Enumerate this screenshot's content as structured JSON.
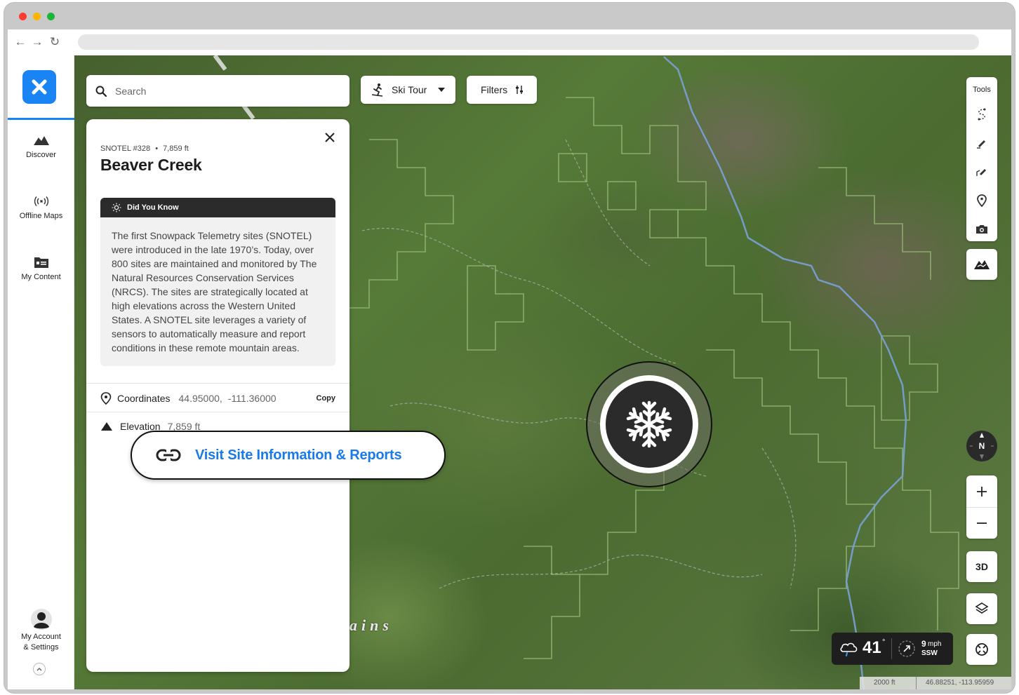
{
  "sidebar": {
    "items": [
      {
        "label": "Discover",
        "icon": "mountain-icon"
      },
      {
        "label": "Offline Maps",
        "icon": "broadcast-icon"
      },
      {
        "label": "My Content",
        "icon": "folder-icon"
      }
    ],
    "account": {
      "line1": "My Account",
      "line2": "& Settings"
    }
  },
  "search": {
    "placeholder": "Search"
  },
  "activity": {
    "label": "Ski Tour"
  },
  "filters": {
    "label": "Filters"
  },
  "panel": {
    "meta_id": "SNOTEL #328",
    "meta_sep": "•",
    "meta_elev": "7,859 ft",
    "title": "Beaver Creek",
    "did_you_know": {
      "heading": "Did You Know",
      "body": "The first Snowpack Telemetry sites (SNOTEL) were introduced in the late 1970’s. Today, over 800 sites are maintained and monitored by The Natural Resources Conservation Services (NRCS). The sites are strategically located at high elevations across the Western United States. A SNOTEL site leverages a variety of sensors to automatically measure and report conditions in these remote mountain areas."
    },
    "coordinates": {
      "label": "Coordinates",
      "lat": "44.95000,",
      "lon": "-111.36000",
      "copy": "Copy"
    },
    "elevation": {
      "label": "Elevation",
      "value": "7,859 ft"
    },
    "visit_link": "Visit Site Information & Reports"
  },
  "tools": {
    "title": "Tools"
  },
  "map_controls": {
    "three_d": "3D",
    "compass": "N"
  },
  "map_labels": {
    "range_fragment": "ains"
  },
  "weather": {
    "temp": "41",
    "deg": "°",
    "wind_speed": "9",
    "wind_unit": "mph",
    "wind_dir": "SSW"
  },
  "scale": {
    "distance": "2000 ft",
    "coords": "46.88251, -113.95959"
  },
  "colors": {
    "brand": "#1a84f5",
    "link": "#1a7ae8",
    "dark": "#2b2b2b"
  }
}
